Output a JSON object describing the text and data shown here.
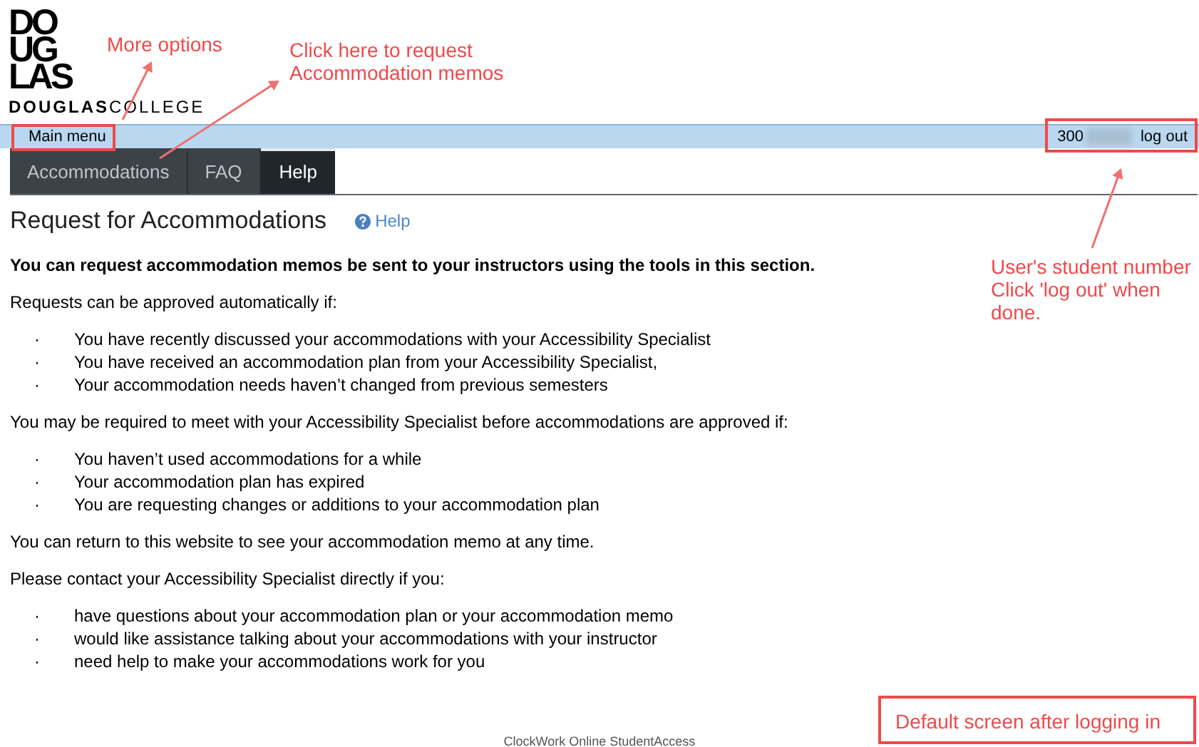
{
  "logo": {
    "mark_lines": [
      "DO",
      "UG",
      "LAS"
    ],
    "wordmark_bold": "DOUGLAS",
    "wordmark_light": "COLLEGE"
  },
  "top_bar": {
    "main_menu": "Main menu",
    "student_number": "300",
    "logout": "log out"
  },
  "tabs": [
    {
      "label": "Accommodations",
      "selected": false
    },
    {
      "label": "FAQ",
      "selected": false
    },
    {
      "label": "Help",
      "selected": true
    }
  ],
  "page_title": "Request for Accommodations",
  "help_link": "Help",
  "content": [
    {
      "kind": "lead",
      "text": "You can request accommodation memos be sent to your instructors using the tools in this section."
    },
    {
      "kind": "paragraph",
      "text": "Requests can be approved automatically if:"
    },
    {
      "kind": "bullets",
      "items": [
        {
          "marker": "·",
          "text": "You have recently discussed your accommodations with your Accessibility Specialist"
        },
        {
          "marker": "·",
          "text": "You have received an accommodation plan from your Accessibility Specialist,"
        },
        {
          "marker": "·",
          "text": "Your accommodation needs haven’t changed from previous semesters"
        }
      ]
    },
    {
      "kind": "paragraph",
      "text": "You may be required to meet with your Accessibility Specialist before accommodations are approved if:"
    },
    {
      "kind": "bullets",
      "items": [
        {
          "marker": "·",
          "text": "You haven’t used accommodations for a while"
        },
        {
          "marker": "·",
          "text": "Your accommodation plan has expired"
        },
        {
          "marker": "·",
          "text": "You are requesting changes or additions to your accommodation plan"
        }
      ]
    },
    {
      "kind": "paragraph",
      "text": "You can return to this website to see your accommodation memo at any time."
    },
    {
      "kind": "paragraph",
      "text": "Please contact your Accessibility Specialist directly if you:"
    },
    {
      "kind": "bullets",
      "items": [
        {
          "marker": "·",
          "text": "have questions about your accommodation plan or your accommodation memo"
        },
        {
          "marker": "·",
          "text": "would like assistance talking about your accommodations with your instructor"
        },
        {
          "marker": "·",
          "text": "need help to make your accommodations work for you"
        }
      ]
    }
  ],
  "footer": "ClockWork Online StudentAccess",
  "annotations": [
    {
      "lines": [
        "More options"
      ]
    },
    {
      "lines": [
        "Click here to request",
        "Accommodation memos"
      ]
    },
    {
      "lines": [
        "User's student number",
        "Click 'log out' when",
        "done."
      ]
    },
    {
      "lines": [
        "Default screen after logging in"
      ]
    }
  ]
}
